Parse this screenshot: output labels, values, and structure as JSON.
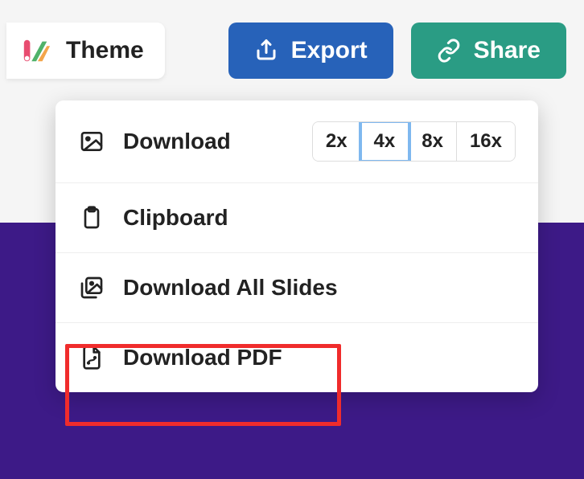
{
  "toolbar": {
    "theme_label": "Theme",
    "export_label": "Export",
    "share_label": "Share"
  },
  "dropdown": {
    "download": {
      "label": "Download",
      "scales": [
        "2x",
        "4x",
        "8x",
        "16x"
      ],
      "selected_scale": "4x"
    },
    "clipboard": {
      "label": "Clipboard"
    },
    "download_all": {
      "label": "Download All Slides"
    },
    "download_pdf": {
      "label": "Download PDF"
    }
  }
}
